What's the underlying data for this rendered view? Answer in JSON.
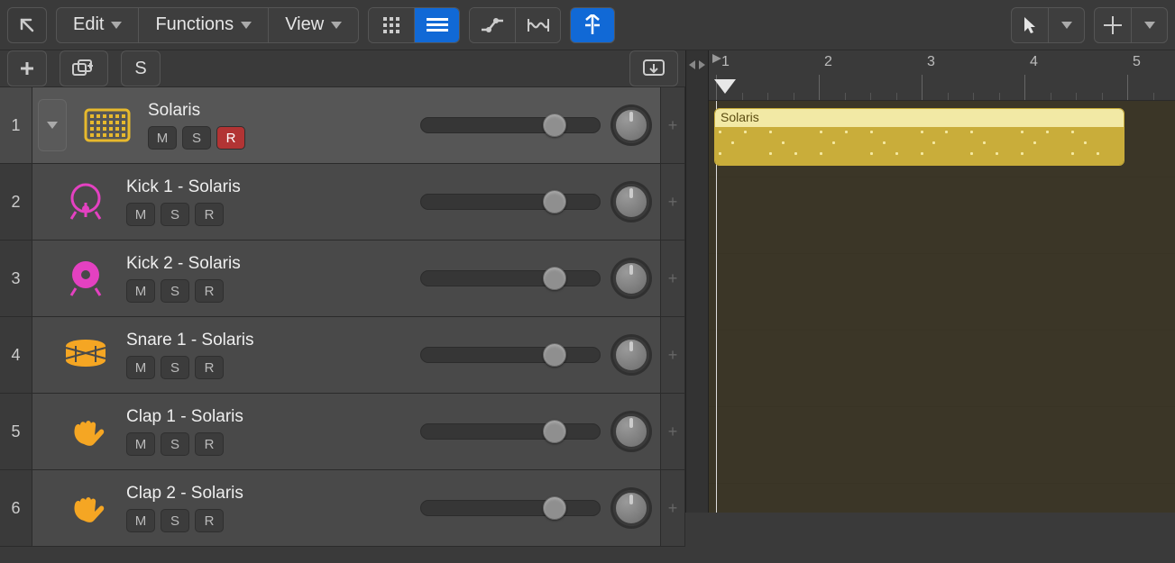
{
  "toolbar": {
    "menu": {
      "edit": "Edit",
      "functions": "Functions",
      "view": "View"
    }
  },
  "secondbar": {
    "solo": "S"
  },
  "ruler": {
    "bars": [
      "1",
      "2",
      "3",
      "4",
      "5"
    ]
  },
  "region": {
    "name": "Solaris"
  },
  "tracks": [
    {
      "num": "1",
      "name": "Solaris",
      "m": "M",
      "s": "S",
      "r": "R",
      "rec": true,
      "icon": "pattern",
      "color": "#e7b92d"
    },
    {
      "num": "2",
      "name": "Kick 1 - Solaris",
      "m": "M",
      "s": "S",
      "r": "R",
      "rec": false,
      "icon": "kick",
      "color": "#e441c1"
    },
    {
      "num": "3",
      "name": "Kick 2 - Solaris",
      "m": "M",
      "s": "S",
      "r": "R",
      "rec": false,
      "icon": "kick2",
      "color": "#e441c1"
    },
    {
      "num": "4",
      "name": "Snare 1 - Solaris",
      "m": "M",
      "s": "S",
      "r": "R",
      "rec": false,
      "icon": "snare",
      "color": "#f5a623"
    },
    {
      "num": "5",
      "name": "Clap 1 - Solaris",
      "m": "M",
      "s": "S",
      "r": "R",
      "rec": false,
      "icon": "clap",
      "color": "#f5a623"
    },
    {
      "num": "6",
      "name": "Clap 2 - Solaris",
      "m": "M",
      "s": "S",
      "r": "R",
      "rec": false,
      "icon": "clap",
      "color": "#f5a623"
    }
  ]
}
